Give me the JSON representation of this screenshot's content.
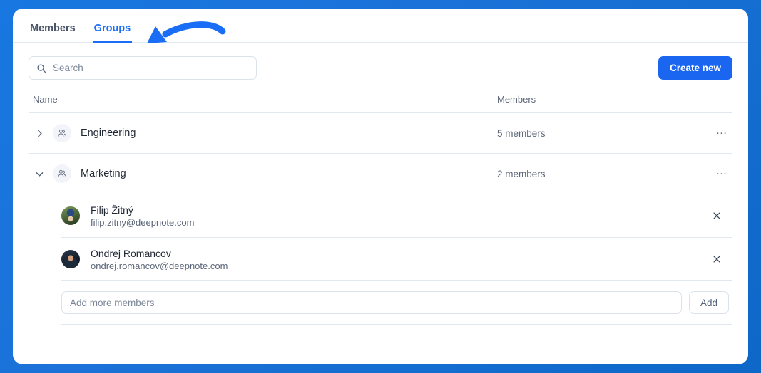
{
  "tabs": [
    {
      "label": "Members",
      "active": false
    },
    {
      "label": "Groups",
      "active": true
    }
  ],
  "annotation": {
    "type": "curved-arrow",
    "color": "#1a6ef5",
    "points_to": "Groups"
  },
  "toolbar": {
    "search_placeholder": "Search",
    "search_value": "",
    "search_icon": "search-icon",
    "create_label": "Create new",
    "accent_color": "#1a66f0"
  },
  "table": {
    "columns": {
      "name": "Name",
      "members": "Members"
    },
    "groups": [
      {
        "name": "Engineering",
        "members_label": "5 members",
        "expanded": false,
        "chevron": "chevron-right-icon",
        "icon": "users-icon",
        "more": "…"
      },
      {
        "name": "Marketing",
        "members_label": "2 members",
        "expanded": true,
        "chevron": "chevron-down-icon",
        "icon": "users-icon",
        "more": "…"
      }
    ]
  },
  "members": [
    {
      "name": "Filip Žitný",
      "email": "filip.zitny@deepnote.com",
      "avatar": "a1",
      "remove_icon": "close-icon"
    },
    {
      "name": "Ondrej Romancov",
      "email": "ondrej.romancov@deepnote.com",
      "avatar": "a2",
      "remove_icon": "close-icon"
    }
  ],
  "add_members": {
    "placeholder": "Add more members",
    "value": "",
    "button_label": "Add"
  }
}
